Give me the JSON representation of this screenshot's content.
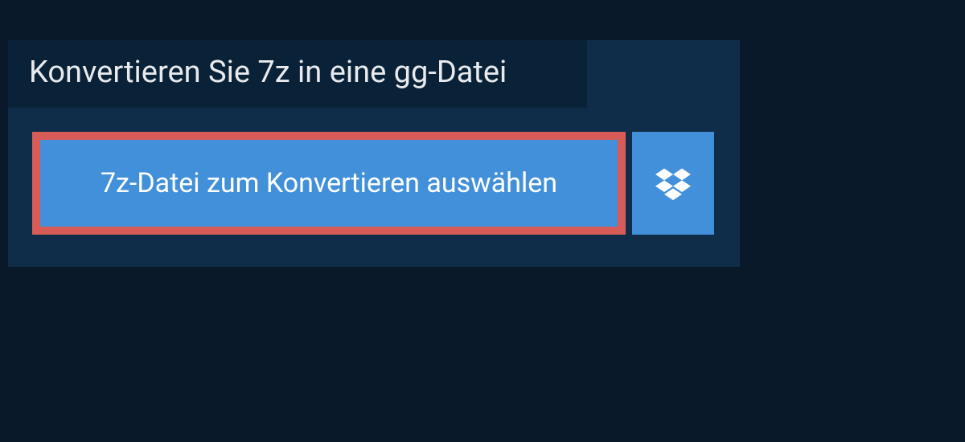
{
  "heading": "Konvertieren Sie 7z in eine gg-Datei",
  "buttons": {
    "select_file": "7z-Datei zum Konvertieren auswählen"
  }
}
